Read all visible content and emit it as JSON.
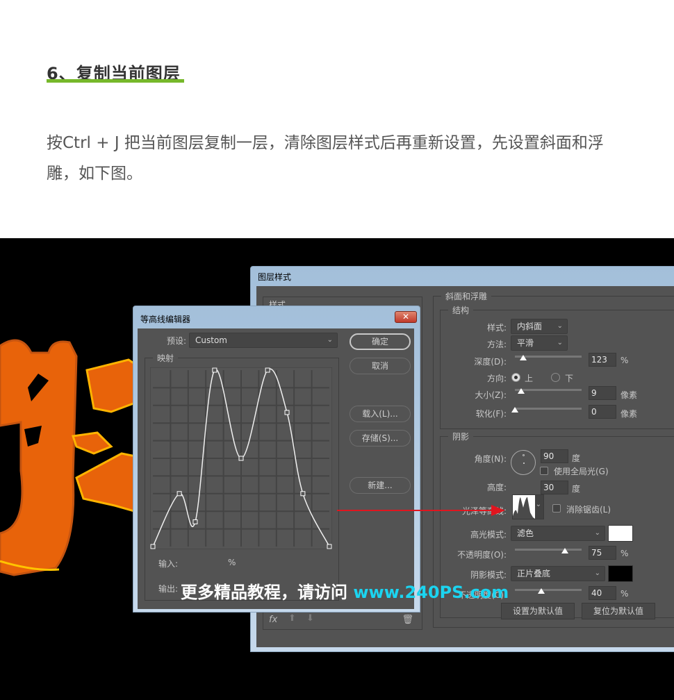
{
  "article": {
    "heading": "6、复制当前图层",
    "heading_accent": "#76b82a",
    "paragraph": "按Ctrl + J 把当前图层复制一层，清除图层样式后再重新设置，先设置斜面和浮雕，如下图。"
  },
  "layer_style_dialog": {
    "title": "图层样式",
    "styles_list_header": "样式",
    "bevel_group": "斜面和浮雕",
    "structure": {
      "legend": "结构",
      "style_label": "样式:",
      "style_value": "内斜面",
      "technique_label": "方法:",
      "technique_value": "平滑",
      "depth_label": "深度(D):",
      "depth_value": "123",
      "depth_unit": "%",
      "depth_slider_fraction": 0.12,
      "direction_label": "方向:",
      "direction_up": "上",
      "direction_down": "下",
      "direction_selected": "上",
      "size_label": "大小(Z):",
      "size_value": "9",
      "size_unit": "像素",
      "size_slider_fraction": 0.09,
      "soften_label": "软化(F):",
      "soften_value": "0",
      "soften_unit": "像素",
      "soften_slider_fraction": 0.0
    },
    "shading": {
      "legend": "阴影",
      "angle_label": "角度(N):",
      "angle_value": "90",
      "angle_unit": "度",
      "global_light_label": "使用全局光(G)",
      "global_light_checked": false,
      "altitude_label": "高度:",
      "altitude_value": "30",
      "altitude_unit": "度",
      "gloss_contour_label": "光泽等高线:",
      "anti_alias_label": "消除锯齿(L)",
      "anti_alias_checked": false,
      "highlight_mode_label": "高光模式:",
      "highlight_mode_value": "滤色",
      "highlight_color": "#ffffff",
      "highlight_opacity_label": "不透明度(O):",
      "highlight_opacity_value": "75",
      "highlight_opacity_unit": "%",
      "shadow_mode_label": "阴影模式:",
      "shadow_mode_value": "正片叠底",
      "shadow_color": "#000000",
      "shadow_opacity_label": "不透明度(C):",
      "shadow_opacity_value": "40",
      "shadow_opacity_unit": "%"
    },
    "make_default": "设置为默认值",
    "reset_default": "复位为默认值",
    "footer_fx": "fx"
  },
  "contour_editor": {
    "title": "等高线编辑器",
    "close_label": "✕",
    "preset_label": "预设:",
    "preset_value": "Custom",
    "mapping_legend": "映射",
    "input_label": "输入:",
    "input_unit": "%",
    "output_label": "输出:",
    "buttons": {
      "ok": "确定",
      "cancel": "取消",
      "load": "载入(L)...",
      "save": "存储(S)...",
      "new": "新建..."
    },
    "curve_points": [
      [
        0,
        0
      ],
      [
        15,
        30
      ],
      [
        24,
        14
      ],
      [
        35,
        100
      ],
      [
        50,
        50
      ],
      [
        65,
        100
      ],
      [
        76,
        76
      ],
      [
        85,
        30
      ],
      [
        100,
        0
      ]
    ]
  },
  "watermark": {
    "text": "更多精品教程，请访问 ",
    "url": "www.240PS.com"
  },
  "annotation_arrow_color": "#e0151f"
}
